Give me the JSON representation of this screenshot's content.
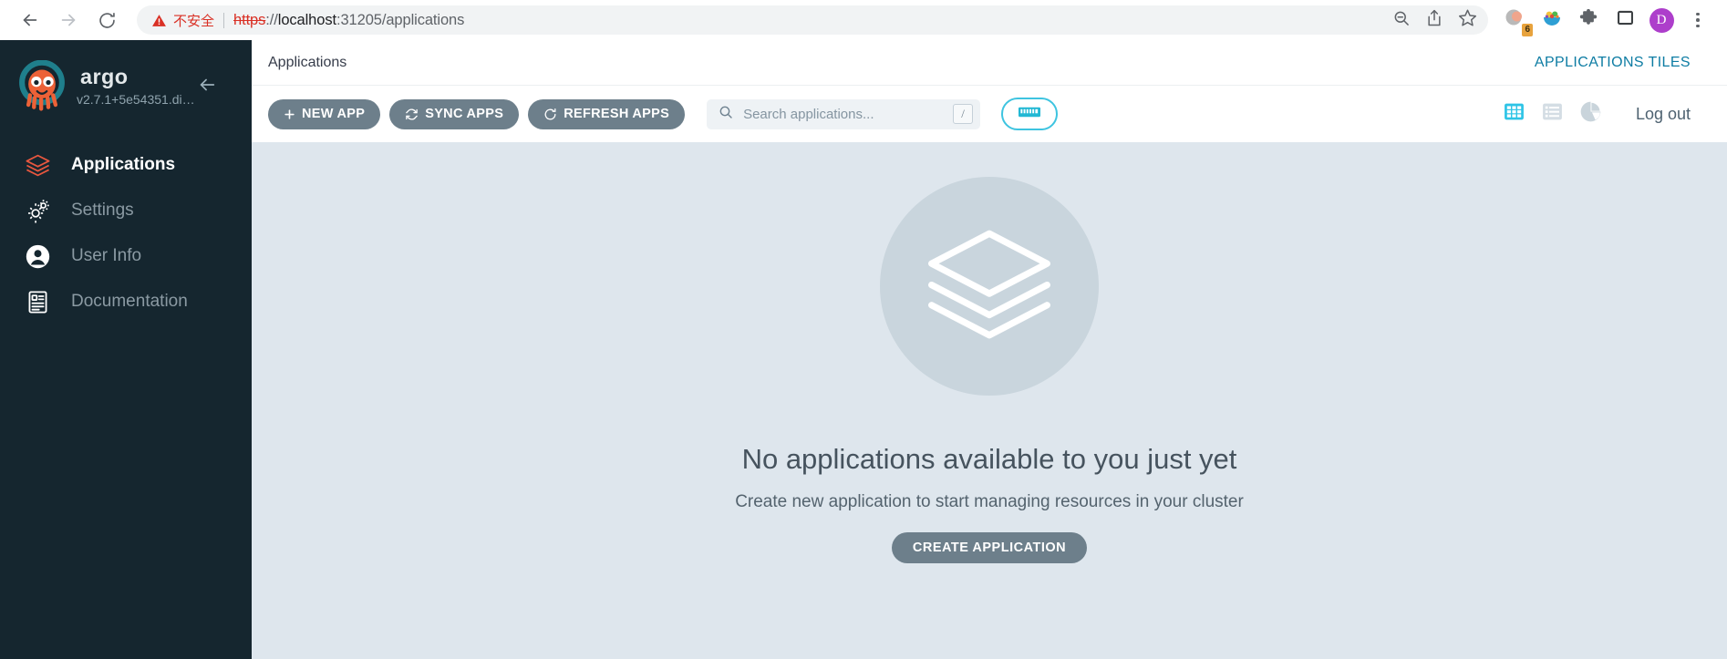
{
  "browser": {
    "back_icon": "arrow-left-icon",
    "forward_icon": "arrow-right-icon",
    "reload_icon": "reload-icon",
    "security_warning_icon": "warning-triangle-icon",
    "security_label": "不安全",
    "url_scheme": "https",
    "url_scheme_suffix": "://",
    "url_host": "localhost",
    "url_rest": ":31205/applications",
    "zoom_out_icon": "zoom-out-icon",
    "share_icon": "share-icon",
    "bookmark_icon": "star-icon",
    "extension_badge_icon": "extension-circle-icon",
    "extension_badge_count": "6",
    "salad_icon": "salad-bowl-icon",
    "puzzle_icon": "puzzle-piece-icon",
    "sidepanel_icon": "side-panel-icon",
    "profile_initial": "D",
    "menu_icon": "kebab-menu-icon"
  },
  "sidebar": {
    "logo_icon": "argo-octopus-logo",
    "brand_name": "argo",
    "version": "v2.7.1+5e54351.di…",
    "collapse_icon": "arrow-left-icon",
    "items": [
      {
        "label": "Applications",
        "icon": "layers-icon",
        "active": true
      },
      {
        "label": "Settings",
        "icon": "gears-icon",
        "active": false
      },
      {
        "label": "User Info",
        "icon": "user-circle-icon",
        "active": false
      },
      {
        "label": "Documentation",
        "icon": "document-icon",
        "active": false
      }
    ]
  },
  "header": {
    "breadcrumb": "Applications",
    "tiles_title": "APPLICATIONS TILES"
  },
  "toolbar": {
    "new_app_label": "NEW APP",
    "new_app_icon": "plus-icon",
    "sync_apps_label": "SYNC APPS",
    "sync_apps_icon": "sync-icon",
    "refresh_apps_label": "REFRESH APPS",
    "refresh_apps_icon": "refresh-icon",
    "search_icon": "search-icon",
    "search_value": "",
    "search_placeholder": "Search applications...",
    "search_shortcut": "/",
    "keyboard_icon": "keyboard-icon",
    "view_tiles_icon": "grid-tiles-icon",
    "view_list_icon": "list-view-icon",
    "view_summary_icon": "pie-chart-icon",
    "logout_label": "Log out"
  },
  "empty_state": {
    "illustration_icon": "layers-stack-icon",
    "title": "No applications available to you just yet",
    "subtitle": "Create new application to start managing resources in your cluster",
    "cta_label": "CREATE APPLICATION"
  },
  "colors": {
    "sidebar_bg": "#15262f",
    "accent_teal": "#3ec4e0",
    "accent_orange": "#e8573f",
    "button_slate": "#6d7f8b",
    "content_bg": "#dee6ed",
    "link_blue": "#0d7ca3",
    "warning_red": "#d93025"
  }
}
